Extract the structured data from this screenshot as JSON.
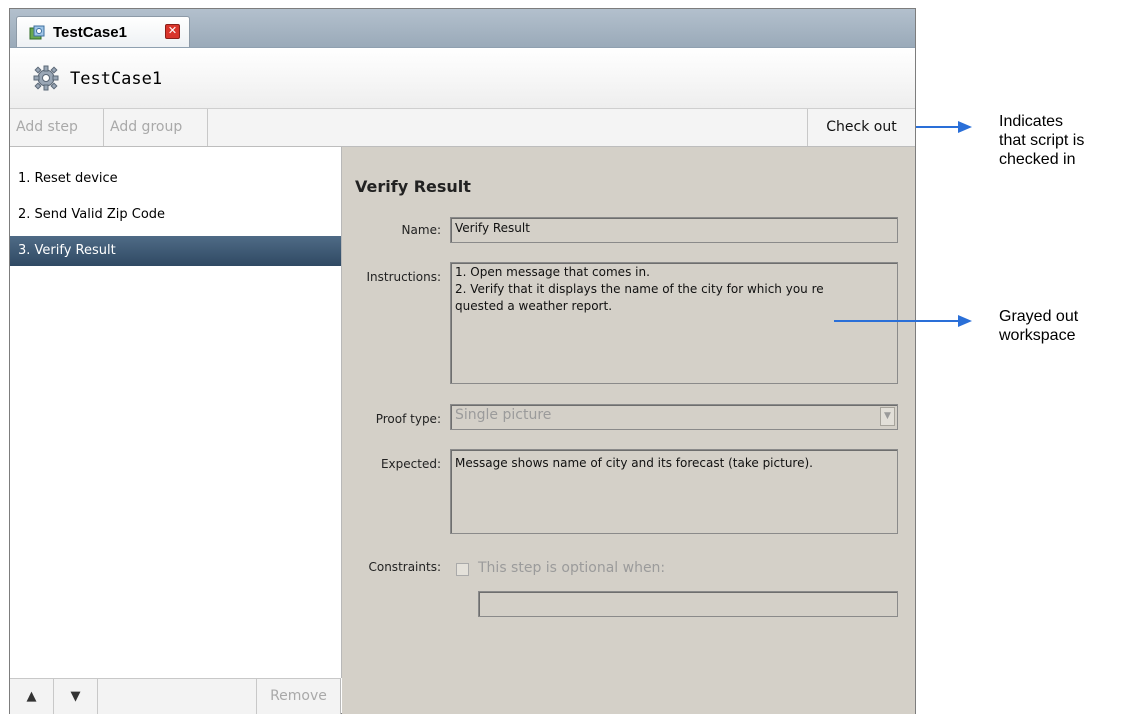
{
  "tab": {
    "title": "TestCase1",
    "close_glyph": "✕",
    "icon": "test-case-icon"
  },
  "header": {
    "title": "TestCase1",
    "icon": "gear-icon"
  },
  "toolbar": {
    "add_step": "Add step",
    "add_group": "Add group",
    "check_out": "Check out"
  },
  "steps": [
    {
      "label": "1. Reset device",
      "selected": false
    },
    {
      "label": "2. Send Valid Zip Code",
      "selected": false
    },
    {
      "label": "3. Verify Result",
      "selected": true
    }
  ],
  "step_actions": {
    "up_glyph": "▲",
    "down_glyph": "▼",
    "remove": "Remove"
  },
  "detail": {
    "heading": "Verify Result",
    "name_label": "Name:",
    "name_value": "Verify Result",
    "instructions_label": "Instructions:",
    "instructions_value": "1. Open message that comes in.\n2. Verify that it displays the name of the city for which you re\nquested a weather report.",
    "proof_type_label": "Proof type:",
    "proof_type_value": "Single picture",
    "expected_label": "Expected:",
    "expected_value": "Message shows name of city and its forecast (take picture).",
    "constraints_label": "Constraints:",
    "optional_checkbox_label": "This step is optional when:",
    "optional_condition_value": ""
  },
  "annotations": {
    "checked_in": "Indicates\nthat script is\nchecked in",
    "grayed_out": "Grayed out\nworkspace"
  },
  "colors": {
    "selected_row": "#3b5570",
    "workspace": "#d4d0c8",
    "annotation_arrow": "#2a6fd8"
  }
}
